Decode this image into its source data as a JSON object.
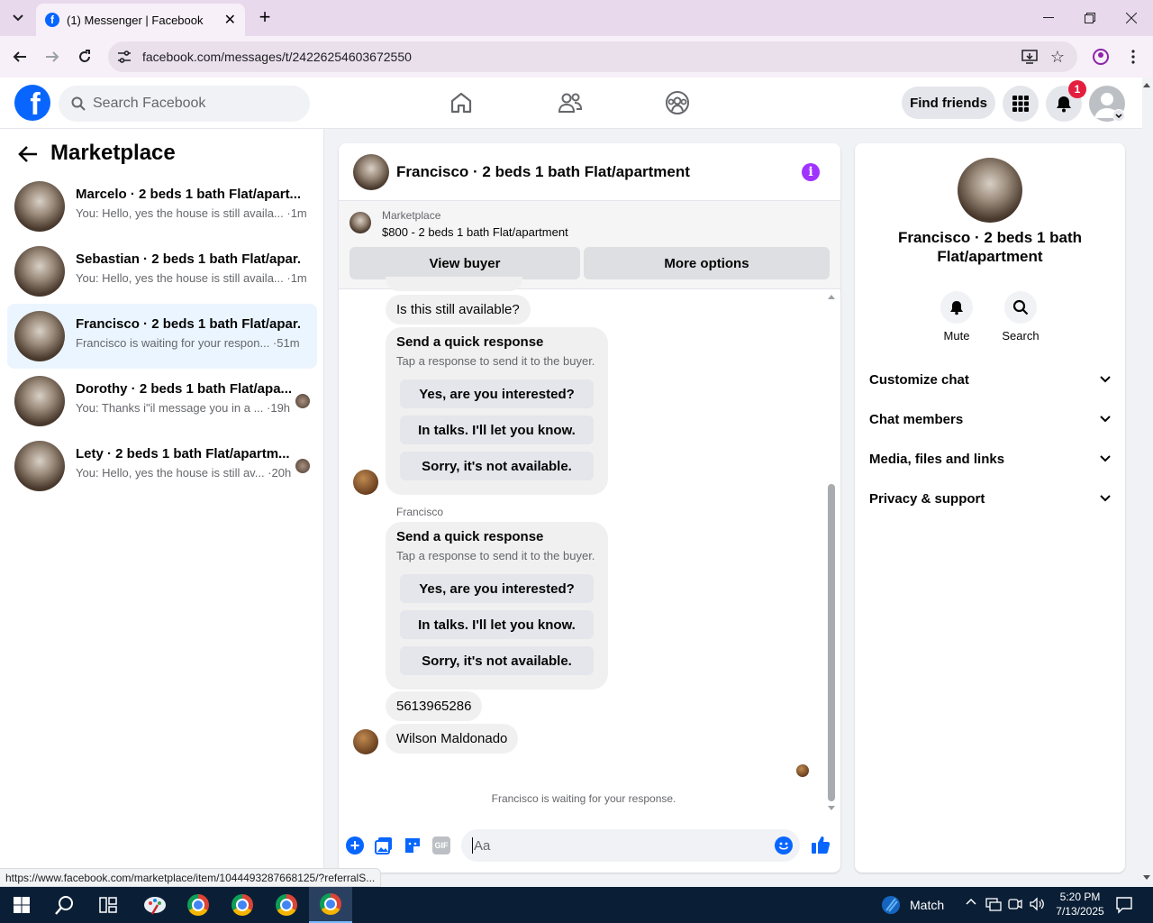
{
  "browser": {
    "tab_title": "(1) Messenger | Facebook",
    "url": "facebook.com/messages/t/24226254603672550",
    "status_url": "https://www.facebook.com/marketplace/item/1044493287668125/?referralS..."
  },
  "header": {
    "search_placeholder": "Search Facebook",
    "find_friends": "Find friends",
    "notification_count": "1"
  },
  "left": {
    "title": "Marketplace",
    "conversations": [
      {
        "name": "Marcelo · 2 beds 1 bath Flat/apart...",
        "preview": "You: Hello, yes the house is still availa... ·1m"
      },
      {
        "name": "Sebastian · 2 beds 1 bath Flat/apar...",
        "preview": "You: Hello, yes the house is still availa... ·1m"
      },
      {
        "name": "Francisco · 2 beds 1 bath Flat/apar...",
        "preview": "Francisco is waiting for your respon... ·51m"
      },
      {
        "name": "Dorothy · 2 beds 1 bath Flat/apa...",
        "preview": "You: Thanks i\"il message you in a ... ·19h"
      },
      {
        "name": "Lety · 2 beds 1 bath Flat/apartm...",
        "preview": "You: Hello, yes the house is still av... ·20h"
      }
    ]
  },
  "chat": {
    "title": "Francisco · 2 beds 1 bath Flat/apartment",
    "listing_label": "Marketplace",
    "listing_title": "$800 - 2 beds 1 bath Flat/apartment",
    "view_buyer": "View buyer",
    "more_options": "More options",
    "msg_available": "Is this still available?",
    "quick_title": "Send a quick response",
    "quick_sub": "Tap a response to send it to the buyer.",
    "quick_options": [
      "Yes, are you interested?",
      "In talks. I'll let you know.",
      "Sorry, it's not available."
    ],
    "sender_name": "Francisco",
    "msg_phone": "5613965286",
    "msg_name": "Wilson Maldonado",
    "waiting": "Francisco is waiting for your response.",
    "composer_placeholder": "Aa"
  },
  "right": {
    "name": "Francisco · 2 beds 1 bath Flat/apartment",
    "mute": "Mute",
    "search": "Search",
    "sections": [
      "Customize chat",
      "Chat members",
      "Media, files and links",
      "Privacy & support"
    ]
  },
  "taskbar": {
    "weather": "Match",
    "time": "5:20 PM",
    "date": "7/13/2025"
  },
  "colors": {
    "fb_blue": "#0866ff",
    "messenger_purple": "#a033ff",
    "badge_red": "#e41e3f"
  }
}
